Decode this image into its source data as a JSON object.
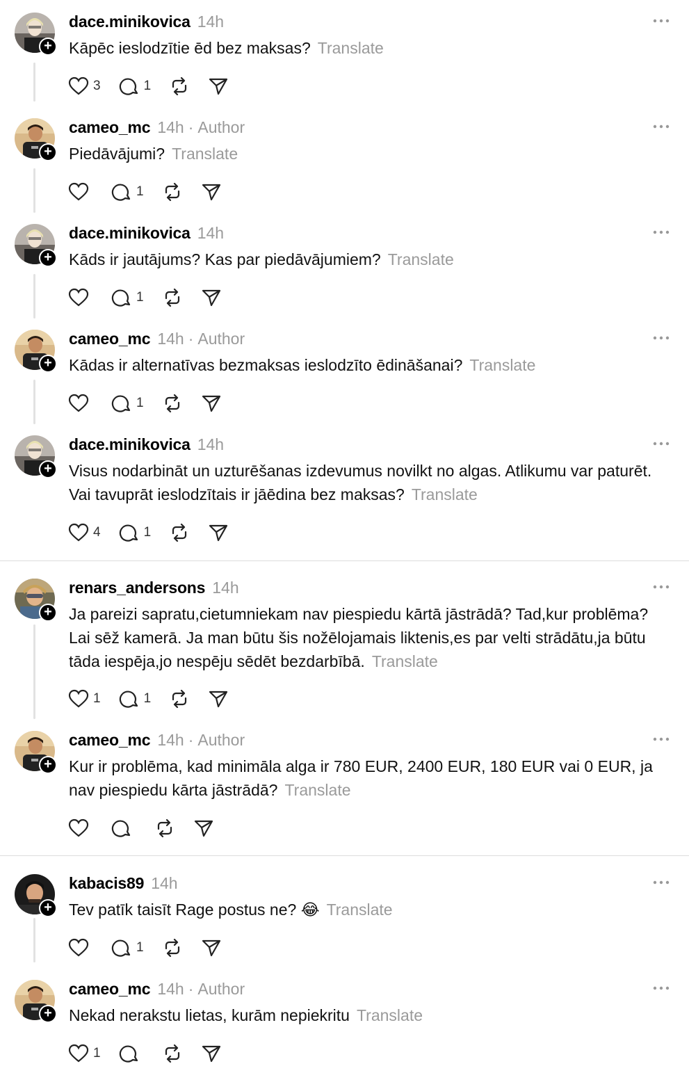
{
  "translate_label": "Translate",
  "posts": [
    {
      "username": "dace.minikovica",
      "time": "14h",
      "author": "",
      "text": "Kāpēc ieslodzītie ēd bez maksas?",
      "likes": "3",
      "replies": "1"
    },
    {
      "username": "cameo_mc",
      "time": "14h",
      "author": "Author",
      "text": "Piedāvājumi?",
      "likes": "",
      "replies": "1"
    },
    {
      "username": "dace.minikovica",
      "time": "14h",
      "author": "",
      "text": "Kāds ir jautājums? Kas par piedāvājumiem?",
      "likes": "",
      "replies": "1"
    },
    {
      "username": "cameo_mc",
      "time": "14h",
      "author": "Author",
      "text": "Kādas ir alternatīvas bezmaksas ieslodzīto ēdināšanai?",
      "likes": "",
      "replies": "1"
    },
    {
      "username": "dace.minikovica",
      "time": "14h",
      "author": "",
      "text": "Visus nodarbināt un uzturēšanas izdevumus novilkt no algas. Atlikumu var paturēt. Vai tavuprāt ieslodzītais ir jāēdina bez maksas?",
      "likes": "4",
      "replies": "1"
    },
    {
      "username": "renars_andersons",
      "time": "14h",
      "author": "",
      "text": "Ja pareizi sapratu,cietumniekam nav piespiedu kārtā jāstrādā? Tad,kur problēma? Lai sēž kamerā. Ja man būtu šis nožēlojamais liktenis,es par velti strādātu,ja būtu tāda iespēja,jo nespēju sēdēt bezdarbībā.",
      "likes": "1",
      "replies": "1"
    },
    {
      "username": "cameo_mc",
      "time": "14h",
      "author": "Author",
      "text": "Kur ir problēma, kad minimāla alga ir 780 EUR, 2400 EUR, 180 EUR vai 0 EUR, ja nav piespiedu kārta jāstrādā?",
      "likes": "",
      "replies": ""
    },
    {
      "username": "kabacis89",
      "time": "14h",
      "author": "",
      "text": "Tev patīk taisīt Rage postus ne? 😂",
      "likes": "",
      "replies": "1"
    },
    {
      "username": "cameo_mc",
      "time": "14h",
      "author": "Author",
      "text": "Nekad nerakstu lietas, kurām nepiekritu",
      "likes": "1",
      "replies": ""
    }
  ],
  "icons": {
    "like": "heart-icon",
    "reply": "comment-icon",
    "repost": "repost-icon",
    "share": "share-icon",
    "more": "more-icon",
    "follow": "plus-icon"
  }
}
